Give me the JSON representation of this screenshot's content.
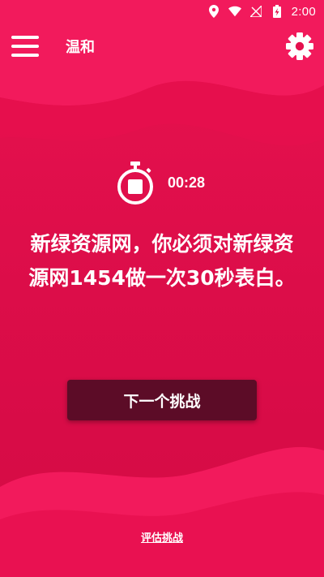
{
  "status_bar": {
    "time": "2:00",
    "icons": [
      "location-icon",
      "wifi-icon",
      "no-signal-icon",
      "battery-charging-icon"
    ]
  },
  "app_bar": {
    "title": "温和",
    "menu_icon": "hamburger-menu-icon",
    "settings_icon": "gear-icon"
  },
  "timer": {
    "icon": "stopwatch-icon",
    "value": "00:28"
  },
  "challenge": {
    "text": "新绿资源网，你必须对新绿资源网1454做一次30秒表白。"
  },
  "actions": {
    "next_label": "下一个挑战",
    "rate_label": "评估挑战"
  },
  "colors": {
    "background": "#e0104c",
    "wave_light": "#f0185a",
    "wave_dark": "#c80a40",
    "button": "#5c0c27",
    "text": "#ffffff"
  }
}
